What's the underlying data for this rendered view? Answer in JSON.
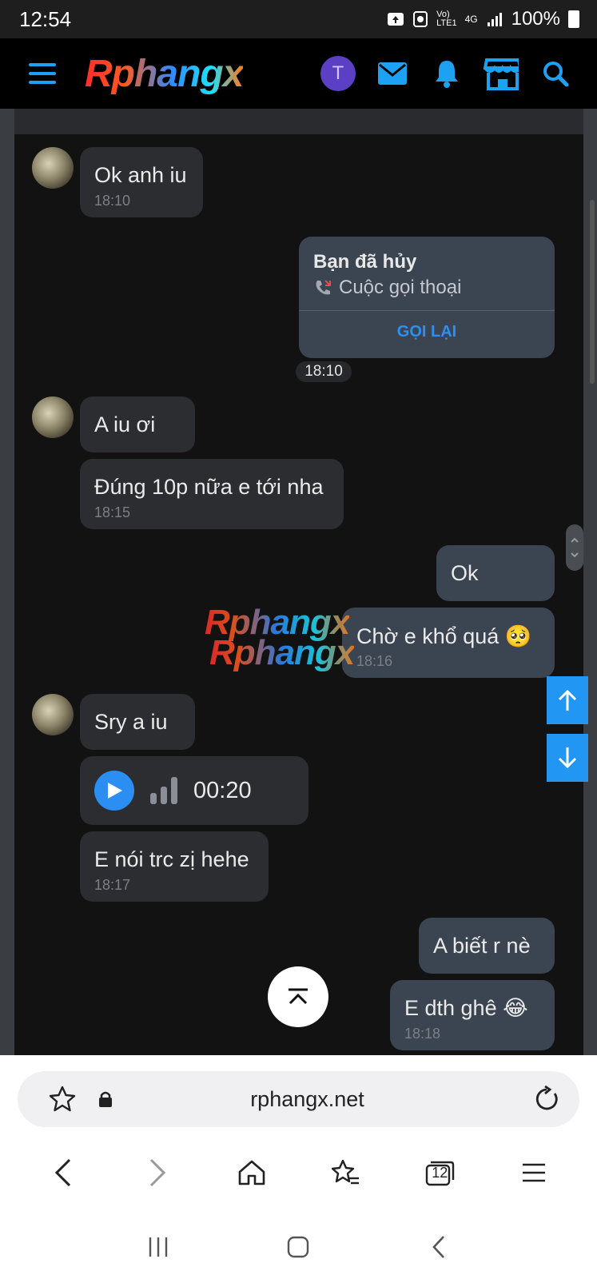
{
  "status_bar": {
    "time": "12:54",
    "network_top": "Vo)",
    "network_bottom": "LTE1",
    "net_type": "4G",
    "battery": "100%"
  },
  "header": {
    "logo": "Rphangx",
    "avatar_letter": "T"
  },
  "chat": {
    "messages": [
      {
        "text": "Ok anh iu",
        "time": "18:10"
      },
      {
        "call_title": "Bạn đã hủy",
        "call_sub": "Cuộc gọi thoại",
        "call_action": "GỌI LẠI",
        "time": "18:10"
      },
      {
        "text": "A iu ơi"
      },
      {
        "text": "Đúng 10p nữa e tới nha",
        "time": "18:15"
      },
      {
        "text": "Ok"
      },
      {
        "text": "Chờ e khổ quá 🥺",
        "time": "18:16"
      },
      {
        "text": "Sry a iu"
      },
      {
        "voice_duration": "00:20"
      },
      {
        "text": "E nói trc zị hehe",
        "time": "18:17"
      },
      {
        "text": "A biết r nè"
      },
      {
        "text": "E dth ghê 😂",
        "time": "18:18"
      }
    ],
    "watermark": "Rphangx"
  },
  "browser": {
    "url": "rphangx.net",
    "tab_count": "12"
  },
  "colors": {
    "accent": "#2196f3",
    "bubble_in": "#2c2d30",
    "bubble_out": "#3b4551",
    "chat_bg": "#121212"
  }
}
